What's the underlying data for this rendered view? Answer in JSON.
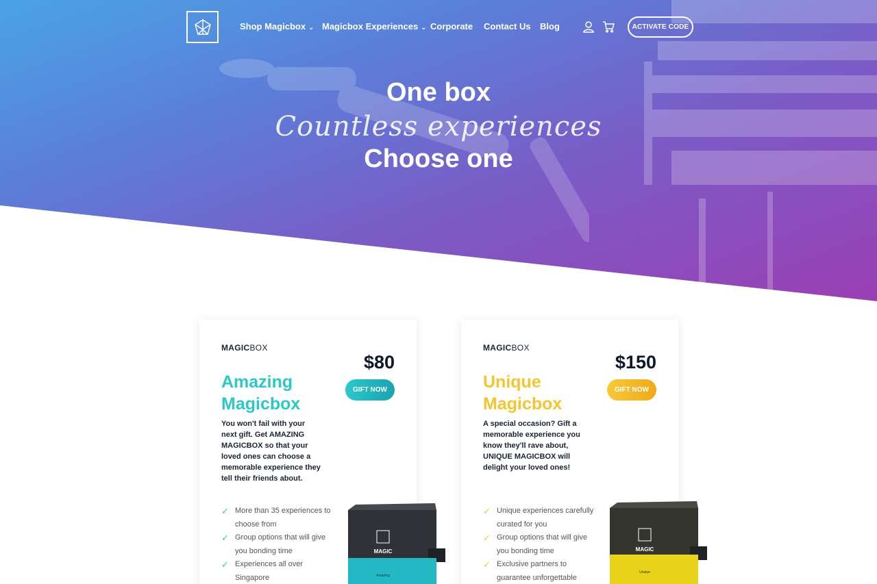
{
  "nav": {
    "logo_icon": "magicbox-logo-icon",
    "items": [
      {
        "label": "Shop Magicbox",
        "dropdown": true
      },
      {
        "label": "Magicbox Experiences",
        "dropdown": true
      },
      {
        "label": "Corporate",
        "dropdown": false
      },
      {
        "label": "Contact Us",
        "dropdown": false
      },
      {
        "label": "Blog",
        "dropdown": false
      }
    ],
    "user_icon": "user-icon",
    "cart_icon": "cart-icon",
    "activate_label": "ACTIVATE CODE"
  },
  "hero": {
    "line1": "One box",
    "line2": "Countless experiences",
    "line3": "Choose one"
  },
  "cards": [
    {
      "brand_bold": "MAGIC",
      "brand_light": "BOX",
      "price": "$80",
      "gift_label": "GIFT NOW",
      "title": "Amazing Magicbox",
      "description": "You won't fail with your next gift. Get AMAZING MAGICBOX so that your loved ones can choose a memorable experience they tell their friends about.",
      "features": [
        "More than 35 experiences to choose from",
        "Group options that will give you bonding time",
        "Experiences all over Singapore"
      ],
      "accent": "#2cc8c9",
      "box_label": "Amazing"
    },
    {
      "brand_bold": "MAGIC",
      "brand_light": "BOX",
      "price": "$150",
      "gift_label": "GIFT NOW",
      "title": "Unique Magicbox",
      "description": "A special occasion? Gift a memorable experience you know they'll rave about, UNIQUE MAGICBOX will delight your loved ones!",
      "features": [
        "Unique experiences carefully curated for you",
        "Group options that will give you bonding time",
        "Exclusive partners to guarantee unforgettable"
      ],
      "accent": "#f4c531",
      "box_label": "Unique"
    }
  ],
  "colors": {
    "hero_start": "#4aa3e6",
    "hero_end": "#9b3fb3",
    "amazing_accent": "#2cc8c9",
    "unique_accent": "#f4c531",
    "text_dark": "#10172b"
  }
}
